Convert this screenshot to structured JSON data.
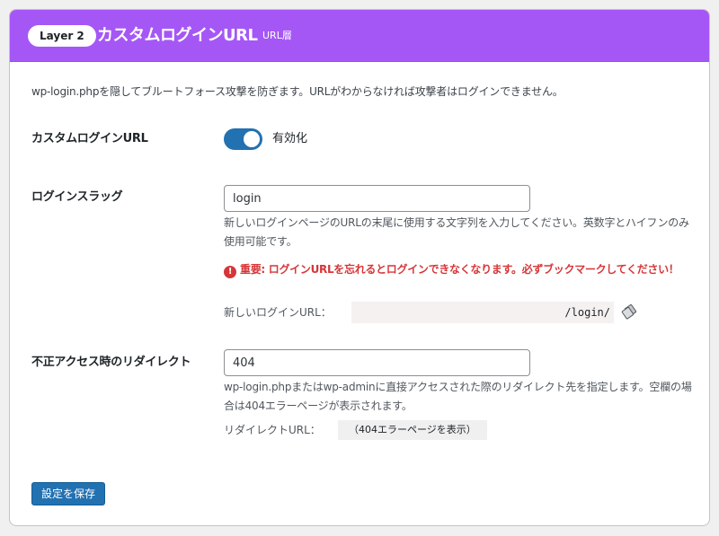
{
  "header": {
    "badge": "Layer 2",
    "title": "カスタムログインURL",
    "subtitle": "URL層",
    "color": "#a557f6"
  },
  "intro": "wp-login.phpを隠してブルートフォース攻撃を防ぎます。URLがわからなければ攻撃者はログインできません。",
  "custom_login": {
    "label": "カスタムログインURL",
    "toggle_on": true,
    "toggle_label": "有効化"
  },
  "login_slug": {
    "label": "ログインスラッグ",
    "value": "login",
    "description": "新しいログインページのURLの末尾に使用する文字列を入力してください。英数字とハイフンのみ使用可能です。",
    "warning_icon": "exclamation-circle-icon",
    "warning": "重要: ログインURLを忘れるとログインできなくなります。必ずブックマークしてください！",
    "url_label": "新しいログインURL：",
    "url_value": "/login/",
    "copy_icon": "copy-icon"
  },
  "redirect": {
    "label": "不正アクセス時のリダイレクト",
    "value": "404",
    "description": "wp-login.phpまたはwp-adminに直接アクセスされた際のリダイレクト先を指定します。空欄の場合は404エラーページが表示されます。",
    "url_label": "リダイレクトURL：",
    "url_value": "（404エラーページを表示）"
  },
  "save_label": "設定を保存",
  "colors": {
    "accent": "#2271b1",
    "warning": "#d63638"
  }
}
